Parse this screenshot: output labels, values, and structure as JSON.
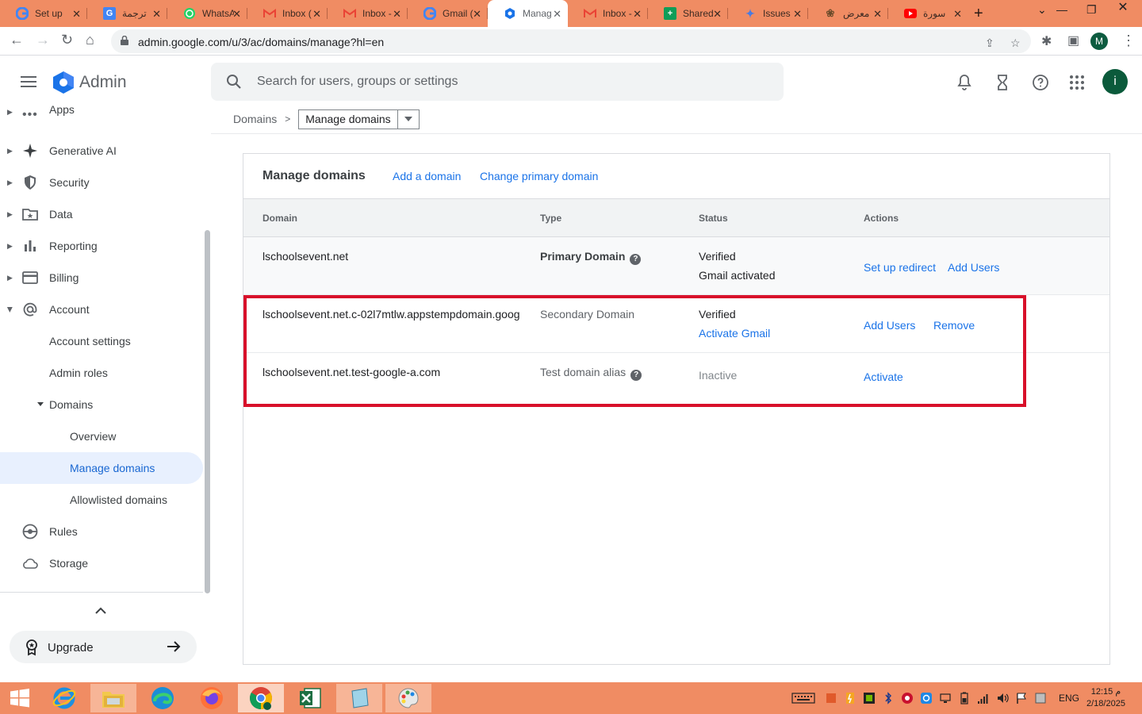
{
  "browser": {
    "tabs": [
      {
        "label": "Set up",
        "icon": "google-icon"
      },
      {
        "label": "ترجمة",
        "icon": "translate-icon"
      },
      {
        "label": "WhatsA",
        "icon": "whatsapp-icon"
      },
      {
        "label": "Inbox (",
        "icon": "gmail-icon"
      },
      {
        "label": "Inbox -",
        "icon": "gmail-icon"
      },
      {
        "label": "Gmail (",
        "icon": "google-icon"
      },
      {
        "label": "Manag",
        "icon": "admin-icon"
      },
      {
        "label": "Inbox -",
        "icon": "gmail-icon"
      },
      {
        "label": "Shared",
        "icon": "sheets-icon"
      },
      {
        "label": "Issues",
        "icon": "gemini-icon"
      },
      {
        "label": "معرض",
        "icon": "gallery-icon"
      },
      {
        "label": "سورة",
        "icon": "youtube-icon"
      }
    ],
    "url": "admin.google.com/u/3/ac/domains/manage?hl=en",
    "profile_initial": "M"
  },
  "header": {
    "title": "Admin",
    "search_placeholder": "Search for users, groups or settings",
    "avatar_initial": "i"
  },
  "sidebar": {
    "items": [
      {
        "label": "Apps"
      },
      {
        "label": "Generative AI"
      },
      {
        "label": "Security"
      },
      {
        "label": "Data"
      },
      {
        "label": "Reporting"
      },
      {
        "label": "Billing"
      },
      {
        "label": "Account"
      },
      {
        "label": "Account settings"
      },
      {
        "label": "Admin roles"
      },
      {
        "label": "Domains"
      },
      {
        "label": "Overview"
      },
      {
        "label": "Manage domains"
      },
      {
        "label": "Allowlisted domains"
      },
      {
        "label": "Rules"
      },
      {
        "label": "Storage"
      }
    ],
    "upgrade_label": "Upgrade"
  },
  "breadcrumb": {
    "parent": "Domains",
    "current": "Manage domains"
  },
  "card": {
    "title": "Manage domains",
    "add_domain": "Add a domain",
    "change_primary": "Change primary domain",
    "columns": [
      "Domain",
      "Type",
      "Status",
      "Actions"
    ],
    "rows": [
      {
        "domain": "lschoolsevent.net",
        "type": "Primary Domain",
        "status_line1": "Verified",
        "status_line2": "Gmail activated",
        "action1": "Set up redirect",
        "action2": "Add Users"
      },
      {
        "domain": "lschoolsevent.net.c-02l7mtlw.appstempdomain.goog",
        "type": "Secondary Domain",
        "status_line1": "Verified",
        "status_line2": "Activate Gmail",
        "action1": "Add Users",
        "action2": "Remove"
      },
      {
        "domain": "lschoolsevent.net.test-google-a.com",
        "type": "Test domain alias",
        "status_line1": "Inactive",
        "action1": "Activate"
      }
    ]
  },
  "taskbar": {
    "lang": "ENG",
    "time": "12:15 م",
    "date": "2/18/2025"
  },
  "colors": {
    "accent": "#1a73e8",
    "highlight": "#d8102a",
    "chrome": "#f08c63"
  }
}
